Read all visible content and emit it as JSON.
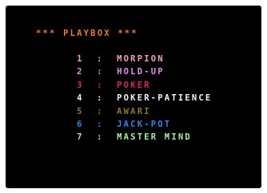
{
  "title": "*** PLAYBOX ***",
  "menu": [
    {
      "number": "1",
      "separator": ":",
      "label": "MORPION",
      "color": "#f2a0b4"
    },
    {
      "number": "2",
      "separator": ":",
      "label": "HOLD-UP",
      "color": "#e58ae8"
    },
    {
      "number": "3",
      "separator": ":",
      "label": "POKER",
      "color": "#d8246c"
    },
    {
      "number": "4",
      "separator": ":",
      "label": "POKER-PATIENCE",
      "color": "#f2f2f0"
    },
    {
      "number": "5",
      "separator": ":",
      "label": "AWARI",
      "color": "#8a7a22"
    },
    {
      "number": "6",
      "separator": ":",
      "label": "JACK-POT",
      "color": "#2f86ee"
    },
    {
      "number": "7",
      "separator": ":",
      "label": "MASTER MIND",
      "color": "#a6ec96"
    }
  ]
}
